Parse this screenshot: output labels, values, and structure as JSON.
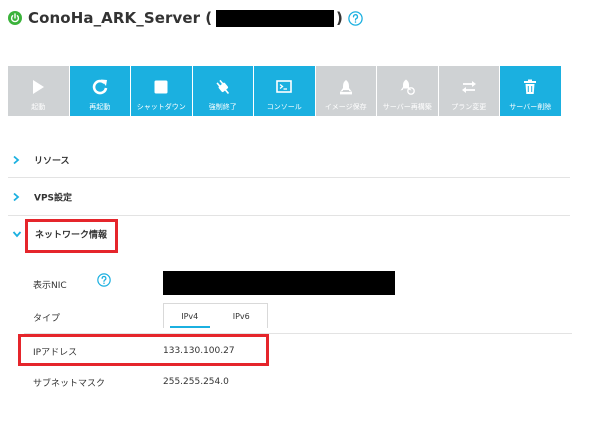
{
  "header": {
    "server_name": "ConoHa_ARK_Server",
    "open_paren": "(",
    "close_paren": ")",
    "status_color": "#3bb33b"
  },
  "toolbar": {
    "buttons": [
      {
        "label": "起動",
        "icon": "play-icon",
        "state": "disabled"
      },
      {
        "label": "再起動",
        "icon": "restart-icon",
        "state": "active"
      },
      {
        "label": "シャットダウン",
        "icon": "stop-icon",
        "state": "active"
      },
      {
        "label": "強制終了",
        "icon": "plug-icon",
        "state": "active"
      },
      {
        "label": "コンソール",
        "icon": "console-icon",
        "state": "active"
      },
      {
        "label": "イメージ保存",
        "icon": "save-image-icon",
        "state": "disabled"
      },
      {
        "label": "サーバー再構築",
        "icon": "rebuild-icon",
        "state": "disabled"
      },
      {
        "label": "プラン変更",
        "icon": "swap-icon",
        "state": "disabled"
      },
      {
        "label": "サーバー削除",
        "icon": "trash-icon",
        "state": "active"
      }
    ],
    "active_color": "#1bb0e0",
    "disabled_color": "#cfd2d4"
  },
  "sections": {
    "resource": "リソース",
    "vps": "VPS設定",
    "network": "ネットワーク情報"
  },
  "network": {
    "nic_label": "表示NIC",
    "type_label": "タイプ",
    "tabs": [
      "IPv4",
      "IPv6"
    ],
    "ip_label": "IPアドレス",
    "ip_value": "133.130.100.27",
    "subnet_label": "サブネットマスク",
    "subnet_value": "255.255.254.0"
  },
  "highlight_color": "#e5252b"
}
